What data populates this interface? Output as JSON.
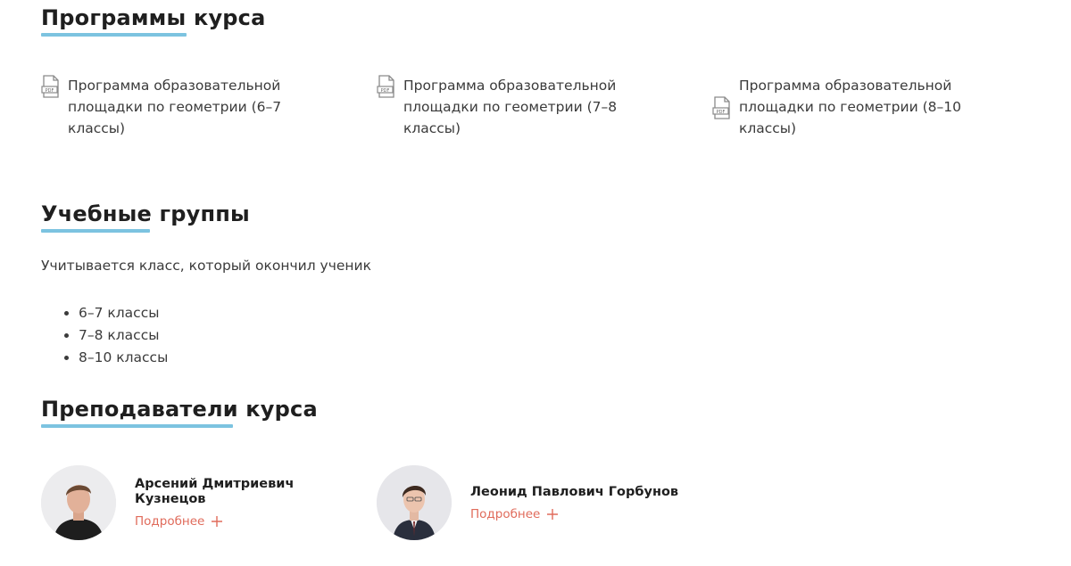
{
  "programs": {
    "title": "Программы курса",
    "items": [
      {
        "label": "Программа образовательной площадки по геометрии (6–7 классы)",
        "icon": "pdf-icon"
      },
      {
        "label": "Программа образовательной площадки по геометрии (7–8 классы)",
        "icon": "pdf-icon"
      },
      {
        "label": "Программа образовательной площадки по геометрии (8–10 классы)",
        "icon": "pdf-icon"
      }
    ]
  },
  "groups": {
    "title": "Учебные группы",
    "description": "Учитывается класс, который окончил ученик",
    "items": [
      "6–7 классы",
      "7–8 классы",
      "8–10 классы"
    ]
  },
  "teachers": {
    "title": "Преподаватели курса",
    "items": [
      {
        "name": "Арсений Дмитриевич Кузнецов",
        "more_label": "Подробнее"
      },
      {
        "name": "Леонид Павлович Горбунов",
        "more_label": "Подробнее"
      }
    ]
  },
  "colors": {
    "accent_underline": "#7cc3e0",
    "link": "#e06b5b",
    "text": "#3b3b3b"
  }
}
